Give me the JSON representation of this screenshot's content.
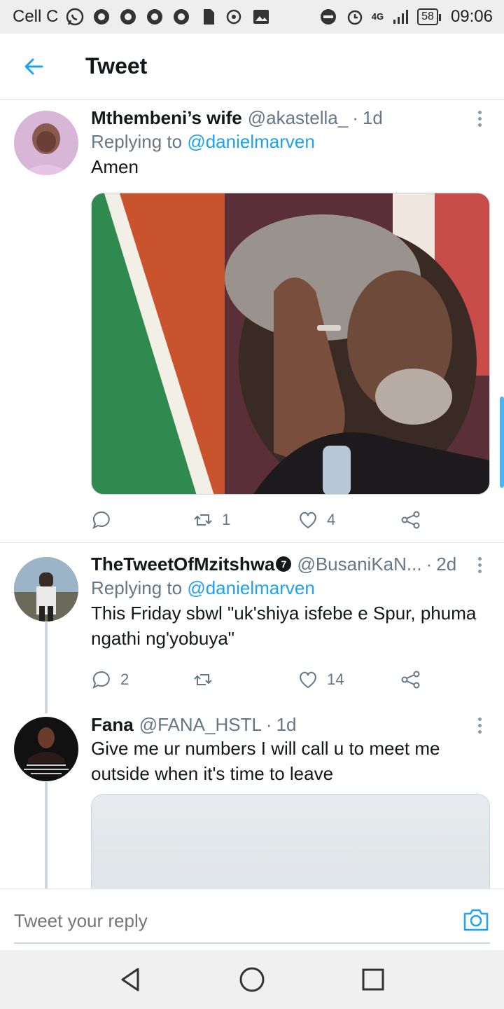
{
  "status_bar": {
    "carrier": "Cell C",
    "network": "4G",
    "battery": "58",
    "time": "09:06"
  },
  "header": {
    "back_icon": "arrow-left-icon",
    "title": "Tweet"
  },
  "tweets": [
    {
      "name": "Mthembeni’s wife",
      "handle": "@akastella_",
      "time": "1d",
      "replying_prefix": "Replying to",
      "replying_to": "@danielmarven",
      "text": "Amen",
      "has_media": true,
      "reply_count": "",
      "retweet_count": "1",
      "like_count": "4"
    },
    {
      "name": "TheTweetOfMzitshwa",
      "verified_badge": "7",
      "handle": "@BusaniKaN...",
      "time": "2d",
      "replying_prefix": "Replying to",
      "replying_to": "@danielmarven",
      "text": "This Friday sbwl \"uk'shiya isfebe e Spur, phuma ngathi ng'yobuya\"",
      "reply_count": "2",
      "retweet_count": "",
      "like_count": "14"
    },
    {
      "name": "Fana",
      "handle": "@FANA_HSTL",
      "time": "1d",
      "text": "Give me ur numbers I will call u to meet me outside when it's time to leave",
      "has_media": true
    }
  ],
  "reply_bar": {
    "placeholder": "Tweet your reply",
    "camera_icon": "camera-icon"
  },
  "colors": {
    "accent": "#1da1f2",
    "secondary_text": "#657786",
    "divider": "#e1e8ed"
  }
}
